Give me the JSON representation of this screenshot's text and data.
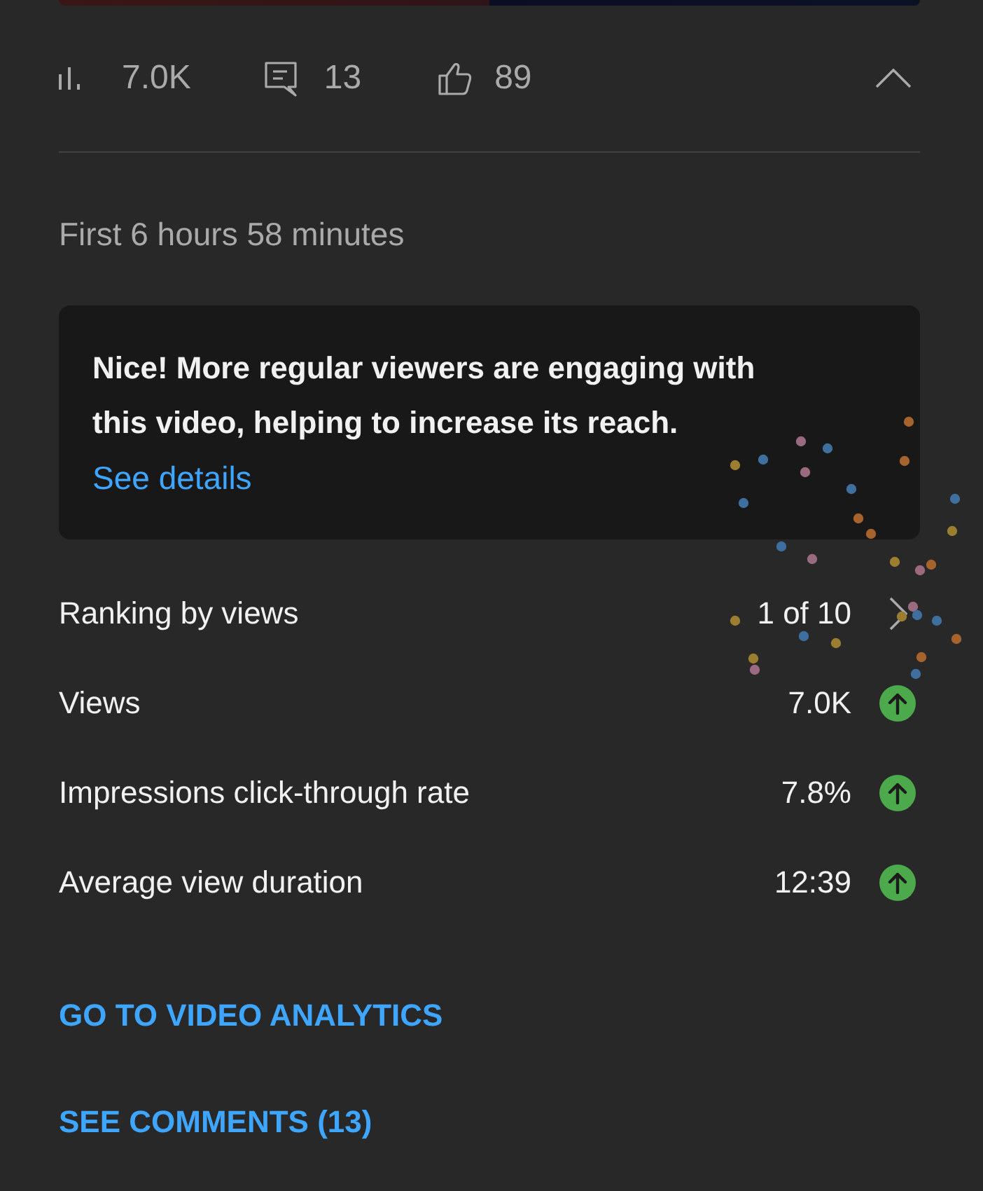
{
  "stats": {
    "views": "7.0K",
    "comments": "13",
    "likes": "89",
    "expanded": true
  },
  "period": "First 6 hours 58 minutes",
  "insight": {
    "message": "Nice! More regular viewers are engaging with this video, helping to increase its reach.",
    "link": "See details"
  },
  "metrics": [
    {
      "kind": "ranking",
      "label": "Ranking by views",
      "value": "1 of 10"
    },
    {
      "kind": "metric",
      "label": "Views",
      "value": "7.0K",
      "rising": true
    },
    {
      "kind": "metric",
      "label": "Impressions click-through rate",
      "value": "7.8%",
      "rising": true
    },
    {
      "kind": "metric",
      "label": "Average view duration",
      "value": "12:39",
      "rising": true
    }
  ],
  "links": [
    "GO TO VIDEO ANALYTICS",
    "SEE COMMENTS (13)"
  ]
}
